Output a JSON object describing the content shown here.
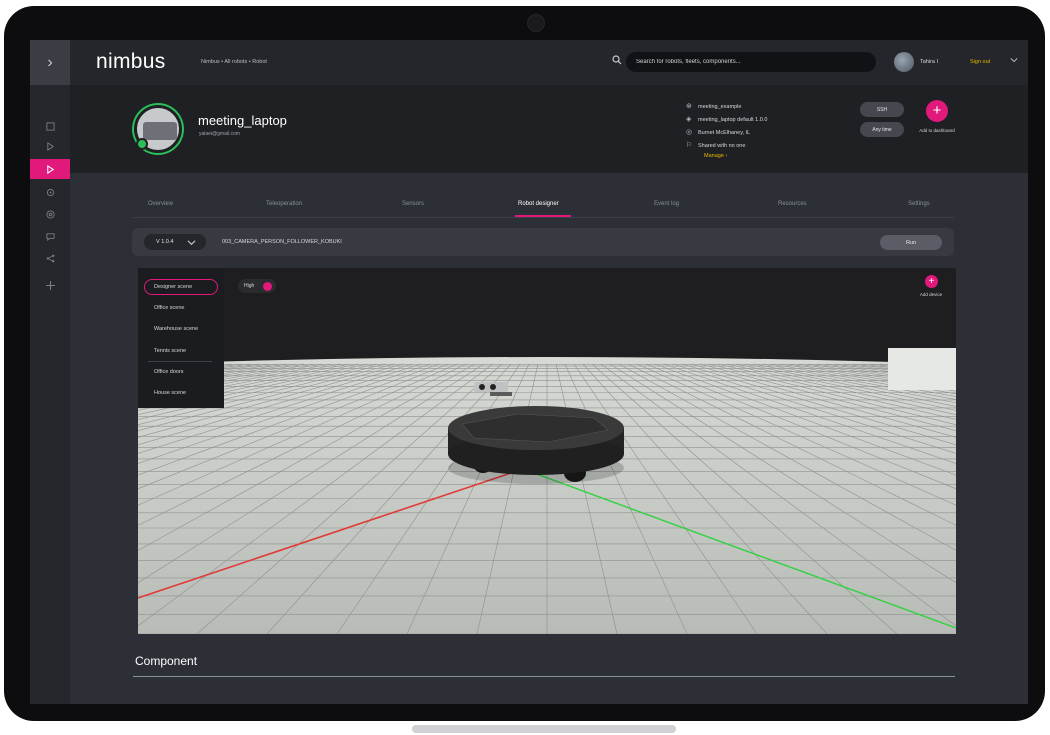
{
  "app": {
    "brand": "nimbus",
    "breadcrumb": "Nimbus • All robots • Robot",
    "search_placeholder": "Search for robots, fleets, components...",
    "user_name": "Tahira I",
    "signout_label": "Sign out"
  },
  "rail": {
    "toggle_glyph": "›",
    "icons": [
      "grid-icon",
      "play-icon",
      "play-outline-icon",
      "gear-icon",
      "target-icon",
      "chat-icon",
      "share-icon",
      "plus-icon"
    ]
  },
  "robot": {
    "name": "meeting_laptop",
    "email": "yalaei@gmail.com",
    "meta": [
      {
        "icon": "robot-icon",
        "text": "meeting_example"
      },
      {
        "icon": "layers-icon",
        "text": "meeting_laptop default 1.0.0"
      },
      {
        "icon": "location-icon",
        "text": "Burnet McElhaney, IL"
      },
      {
        "icon": "flag-icon",
        "text": "Shared with no one"
      }
    ],
    "manage_label": "Manage ›",
    "pill_1": "SSH",
    "pill_2": "Any time",
    "add_dashboard_label": "Add to dashboard"
  },
  "tabs": [
    "Overview",
    "Teleoperation",
    "Sensors",
    "Robot designer",
    "Event log",
    "Resources",
    "Settings"
  ],
  "active_tab": "Robot designer",
  "version_bar": {
    "version": "V 1.0.4",
    "name": "003_CAMERA_PERSON_FOLLOWER_KOBUKI",
    "run_label": "Run"
  },
  "viewer": {
    "scenes": [
      "Designer scene",
      "Office scene",
      "Warehouse scene",
      "Tennis scene",
      "Office doors",
      "House scene"
    ],
    "active_scene": "Designer scene",
    "high_label": "High",
    "high_on": true,
    "add_device_label": "Add device",
    "colors": {
      "x_axis": "#e03a3a",
      "y_axis": "#2fd23f",
      "floor": "#c9cdc8",
      "grid": "#8e928d"
    }
  },
  "component": {
    "title": "Component"
  },
  "colors": {
    "accent": "#e0197a",
    "online": "#2bbf59",
    "link": "#e6b800"
  }
}
